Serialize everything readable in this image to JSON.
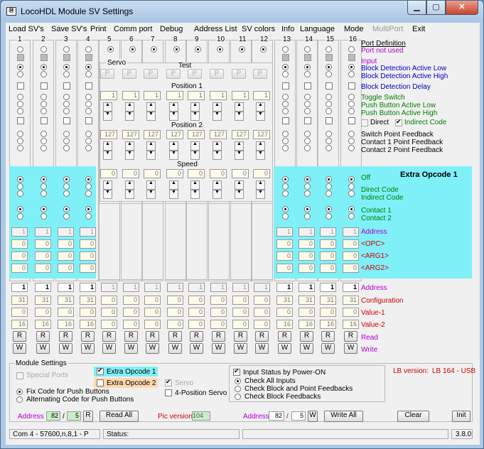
{
  "window": {
    "title": "LocoHDL Module SV Settings",
    "app_icon": "Ⓜ"
  },
  "menu": [
    "Load SV's",
    "Save SV's",
    "Print",
    "Comm port",
    "Debug",
    "Address List",
    "SV colors",
    "Info",
    "Language",
    "Mode",
    "MultiPort",
    "Exit"
  ],
  "columns": [
    "1",
    "2",
    "3",
    "4",
    "5",
    "6",
    "7",
    "8",
    "9",
    "10",
    "11",
    "12",
    "13",
    "14",
    "15",
    "16"
  ],
  "port_definition": {
    "header": "Port Definition",
    "not_used": "Port not used",
    "input": "Input",
    "bd_low": "Block Detection Active Low",
    "bd_high": "Block Detection Active High",
    "bd_delay": "Block Detection Delay",
    "toggle": "Toggle Switch",
    "push_low": "Push Button Active Low",
    "push_high": "Push Button Active High",
    "direct": "Direct",
    "indirect": "Indirect Code",
    "sw_feedback": "Switch Point Feedback",
    "c1_feedback": "Contact 1 Point Feedback",
    "c2_feedback": "Contact 2 Point Feedback"
  },
  "servo": {
    "title": "Servo",
    "test": "Test",
    "p_btn": "P",
    "position1": "Position 1",
    "position2": "Position 2",
    "speed": "Speed",
    "pos1_value": "1",
    "pos2_value": "127",
    "speed_value": "0"
  },
  "extra": {
    "title": "Extra Opcode 1",
    "off": "Off",
    "direct_code": "Direct Code",
    "indirect_code": "Indirect Code",
    "contact1": "Contact 1",
    "contact2": "Contact 2",
    "address": "Address",
    "opc": "<OPC>",
    "arg1": "<ARG1>",
    "arg2": "<ARG2>"
  },
  "extra_values": {
    "address": "1",
    "opc": "0",
    "arg1": "0",
    "arg2": "0"
  },
  "bottom_labels": {
    "address": "Address",
    "configuration": "Configuration",
    "value1": "Value-1",
    "value2": "Value-2",
    "read": "Read",
    "write": "Write"
  },
  "bottom_values": {
    "address": [
      "1",
      "1",
      "1",
      "1",
      "1",
      "1",
      "1",
      "1",
      "1",
      "1",
      "1",
      "1",
      "1",
      "1",
      "1",
      "1"
    ],
    "config": [
      "31",
      "31",
      "31",
      "31",
      "0",
      "0",
      "0",
      "0",
      "0",
      "0",
      "0",
      "0",
      "31",
      "31",
      "31",
      "31"
    ],
    "value1": [
      "0",
      "0",
      "0",
      "0",
      "0",
      "0",
      "0",
      "0",
      "0",
      "0",
      "0",
      "0",
      "0",
      "0",
      "0",
      "0"
    ],
    "value2": [
      "16",
      "16",
      "16",
      "16",
      "0",
      "0",
      "0",
      "0",
      "0",
      "0",
      "0",
      "0",
      "16",
      "16",
      "16",
      "16"
    ],
    "r": "R",
    "w": "W"
  },
  "module_settings": {
    "title": "Module Settings",
    "special_ports": "Special Ports",
    "extra_opcode1": "Extra Opcode 1",
    "extra_opcode2": "Extra Opcode 2",
    "servo": "Servo",
    "four_pos_servo": "4-Position Servo",
    "fix_code": "Fix Code for Push Buttons",
    "alt_code": "Alternating Code for Push Buttons",
    "input_status": "Input Status by Power-ON",
    "check_all": "Check All Inputs",
    "check_block_point": "Check Block and Point Feedbacks",
    "check_block": "Check Block Feedbacks",
    "lb_version_label": "LB version:",
    "lb_version_value": "LB 164 - USB"
  },
  "controls": {
    "address_label": "Address",
    "address1": "82",
    "slash": "/",
    "address2": "5",
    "r": "R",
    "read_all": "Read All",
    "pic_version_label": "Pic version",
    "pic_version_value": "104",
    "address_label2": "Address",
    "address3": "82",
    "address4": "5",
    "w": "W",
    "write_all": "Write All",
    "clear": "Clear",
    "init": "Init"
  },
  "status": {
    "port": "Com 4 - 57600,n,8,1 - P",
    "status_label": "Status:",
    "version": "3.8.0"
  },
  "colors": {
    "cyan": "#7ff0f8",
    "purple": "#b000d0",
    "blue": "#0000c0",
    "green": "#008000",
    "red": "#d00000",
    "black": "#000000"
  }
}
